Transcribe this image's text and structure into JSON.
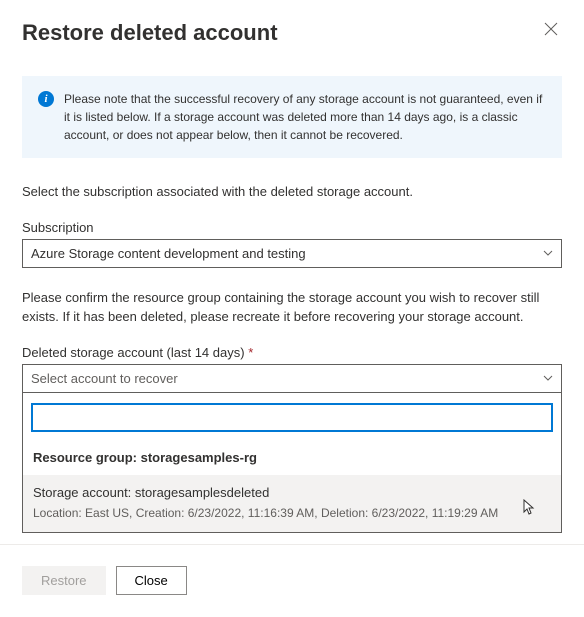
{
  "header": {
    "title": "Restore deleted account"
  },
  "info": {
    "text": "Please note that the successful recovery of any storage account is not guaranteed, even if it is listed below. If a storage account was deleted more than 14 days ago, is a classic account, or does not appear below, then it cannot be recovered."
  },
  "instruction1": "Select the subscription associated with the deleted storage account.",
  "subscription": {
    "label": "Subscription",
    "value": "Azure Storage content development and testing"
  },
  "instruction2": "Please confirm the resource group containing the storage account you wish to recover still exists. If it has been deleted, please recreate it before recovering your storage account.",
  "deleted": {
    "label": "Deleted storage account (last 14 days)",
    "placeholder": "Select account to recover",
    "group_header": "Resource group: storagesamples-rg",
    "option": {
      "title": "Storage account: storagesamplesdeleted",
      "meta": "Location: East US, Creation: 6/23/2022, 11:16:39 AM, Deletion: 6/23/2022, 11:19:29 AM"
    }
  },
  "footer": {
    "restore": "Restore",
    "close": "Close"
  }
}
